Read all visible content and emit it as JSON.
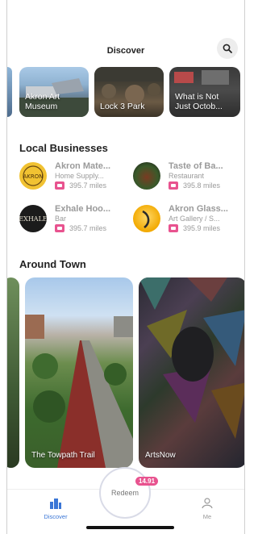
{
  "header": {
    "title": "Discover",
    "search_icon": "search-icon"
  },
  "top_carousel": [
    {
      "label": "Akron Art\nMuseum"
    },
    {
      "label": "Lock 3 Park"
    },
    {
      "label": "What is Not\nJust Octob..."
    }
  ],
  "local_businesses": {
    "title": "Local Businesses",
    "items": [
      {
        "name": "Akron Mate...",
        "category": "Home Supply...",
        "distance": "395.7 miles"
      },
      {
        "name": "Taste of Ba...",
        "category": "Restaurant",
        "distance": "395.8 miles"
      },
      {
        "name": "Exhale Hoo...",
        "category": "Bar",
        "distance": "395.7 miles"
      },
      {
        "name": "Akron Glass...",
        "category": "Art Gallery / S...",
        "distance": "395.9 miles"
      }
    ]
  },
  "around_town": {
    "title": "Around Town",
    "items": [
      {
        "label": "The Towpath Trail"
      },
      {
        "label": "ArtsNow"
      }
    ]
  },
  "bottom_nav": {
    "discover_label": "Discover",
    "redeem_label": "Redeem",
    "redeem_badge": "14.91",
    "me_label": "Me",
    "accent": "#3a76d6",
    "badge_color": "#e8538f"
  }
}
